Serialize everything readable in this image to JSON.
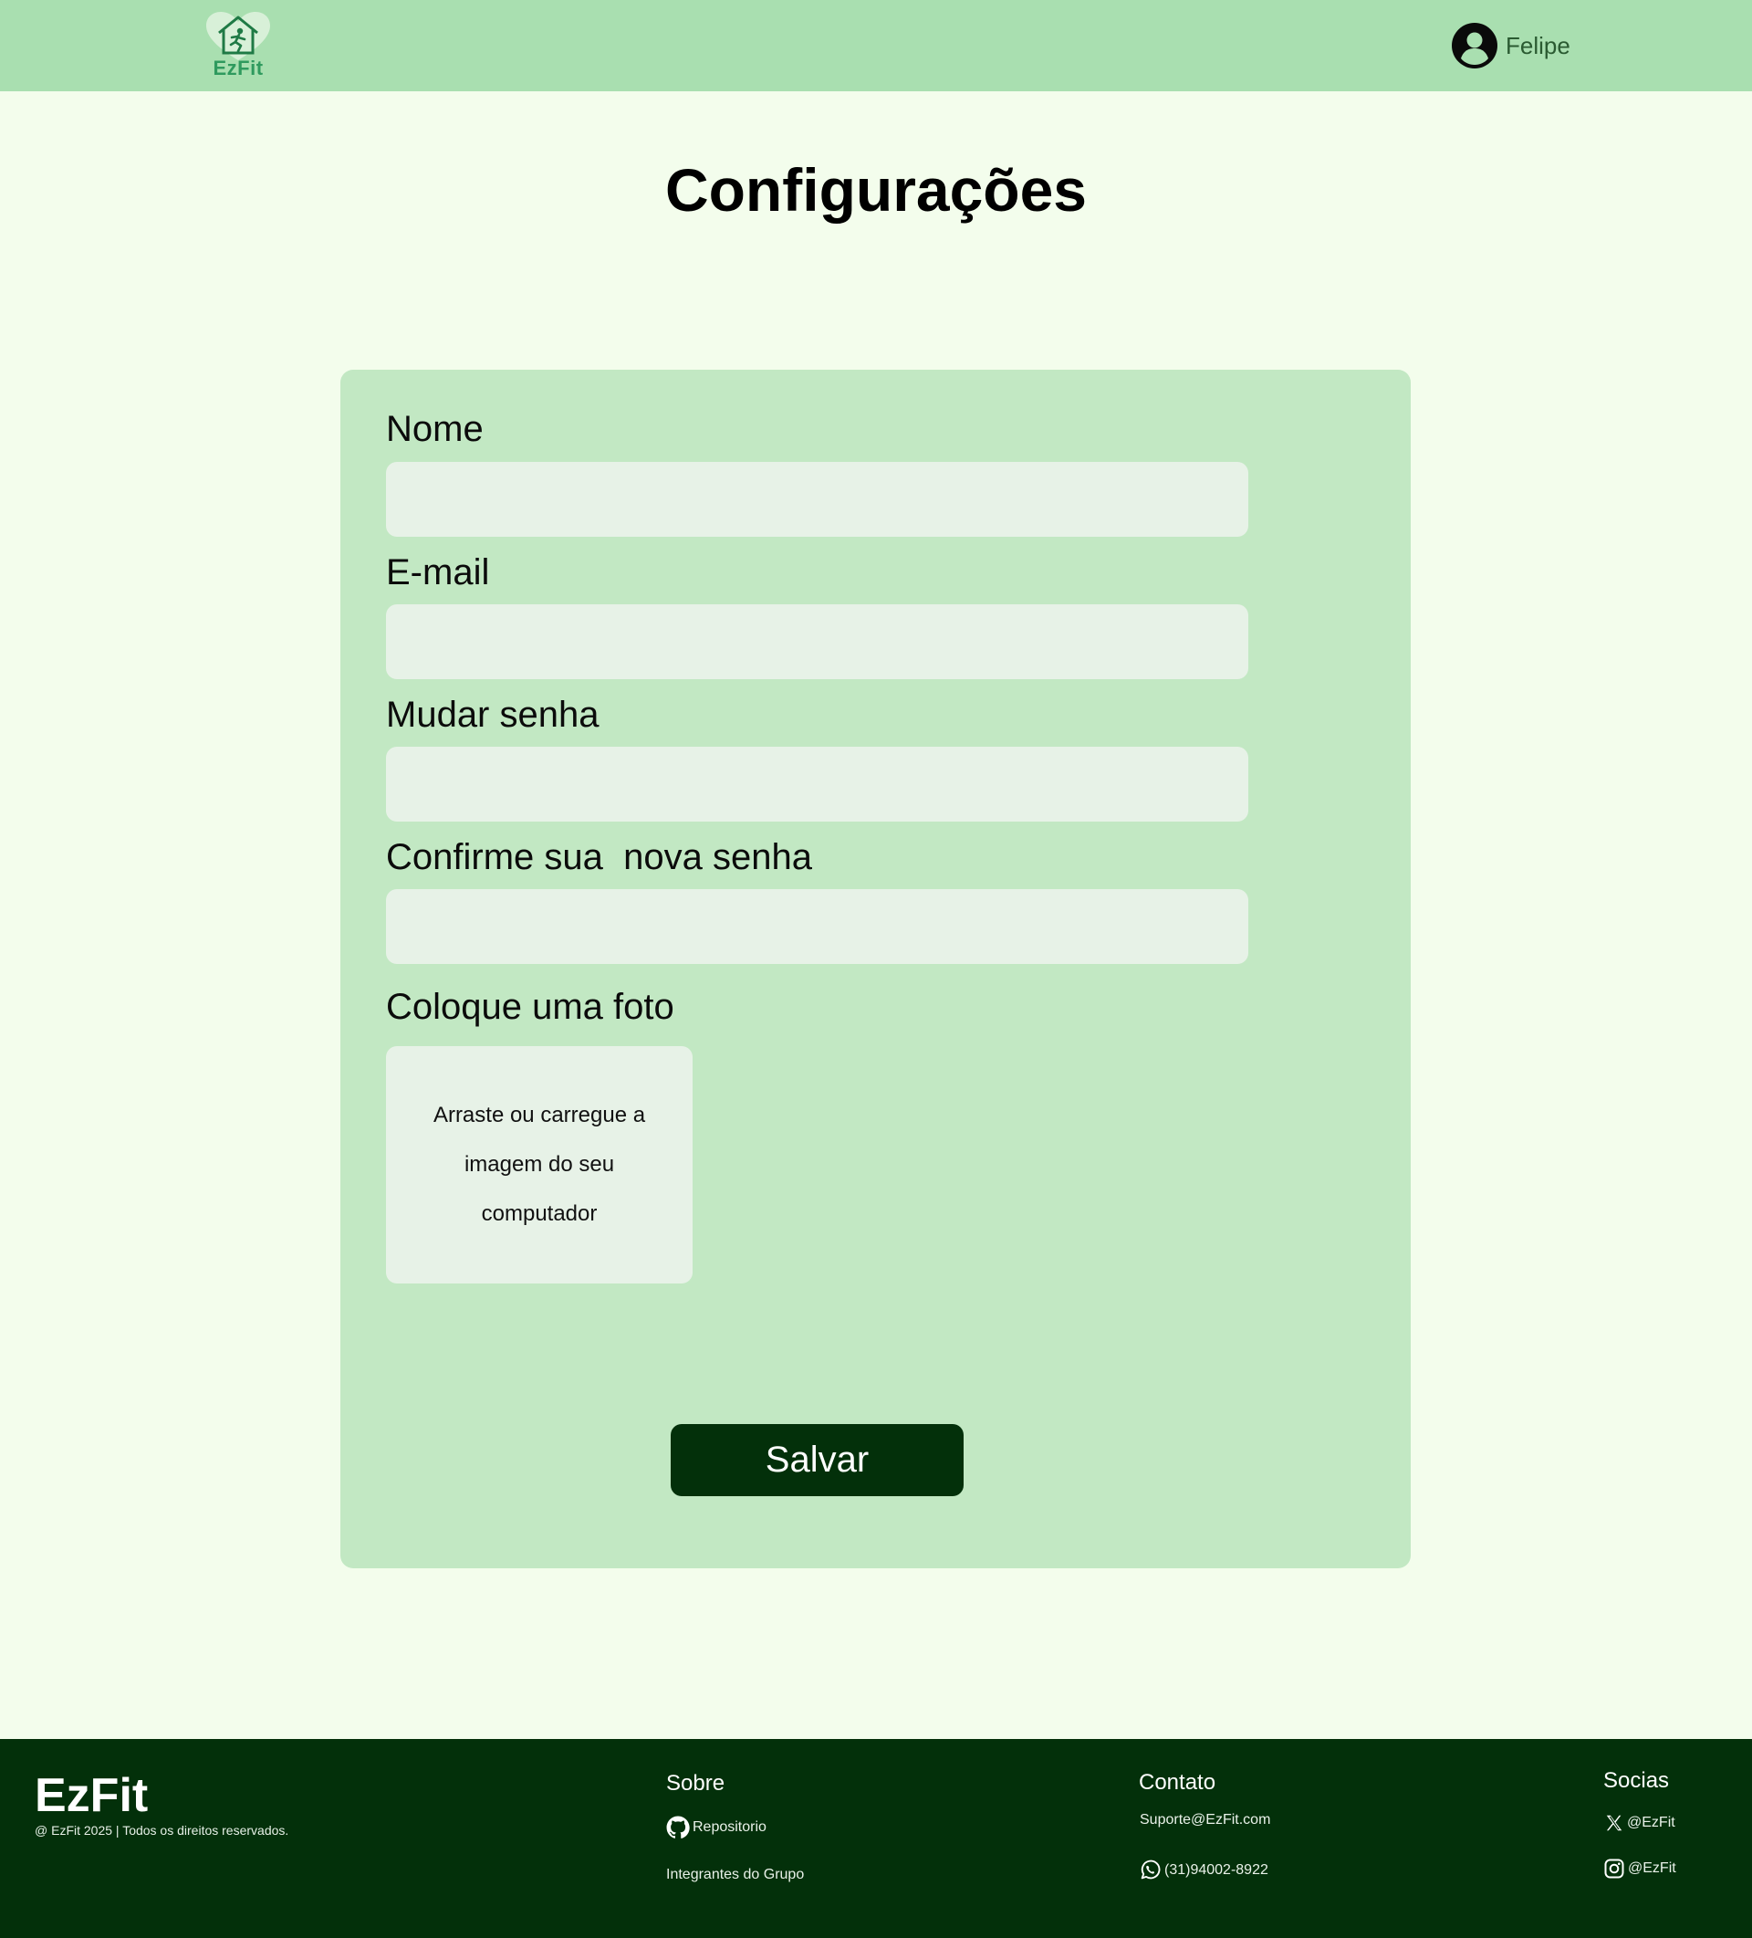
{
  "header": {
    "logo_text": "EzFit",
    "user_name": "Felipe"
  },
  "page": {
    "title": "Configurações"
  },
  "form": {
    "name_label": "Nome",
    "name_value": "",
    "email_label": "E-mail",
    "email_value": "",
    "password_label": "Mudar senha",
    "password_value": "",
    "confirm_label": "Confirme sua  nova senha",
    "confirm_value": "",
    "photo_label": "Coloque uma foto",
    "photo_dropzone_text": "Arraste ou carregue a imagem do seu computador",
    "save_label": "Salvar"
  },
  "footer": {
    "brand": "EzFit",
    "copyright": "@ EzFit 2025 | Todos os direitos reservados.",
    "about": {
      "heading": "Sobre",
      "repo_label": "Repositorio",
      "repo_icon": "github-icon",
      "team_label": "Integrantes do Grupo"
    },
    "contact": {
      "heading": "Contato",
      "email": "Suporte@EzFit.com",
      "phone": "(31)94002-8922",
      "phone_icon": "whatsapp-icon"
    },
    "socials": {
      "heading": "Socias",
      "x_handle": "@EzFit",
      "x_icon": "x-icon",
      "instagram_handle": "@EzFit",
      "instagram_icon": "instagram-icon"
    }
  },
  "colors": {
    "page_background": "#f3fdec",
    "header_background": "#a9dfb0",
    "card_background": "#c2e8c3",
    "input_background": "#e7f2e7",
    "button_background": "#03300a",
    "footer_background": "#03300a"
  }
}
